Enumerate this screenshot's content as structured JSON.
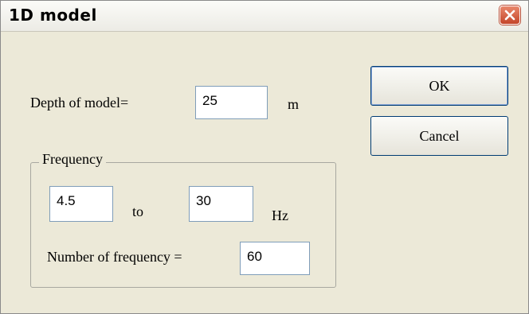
{
  "window": {
    "title": "1D model"
  },
  "depth": {
    "label": "Depth of model=",
    "value": "25",
    "unit": "m"
  },
  "buttons": {
    "ok": "OK",
    "cancel": "Cancel"
  },
  "frequency_group": {
    "legend": "Frequency",
    "from_value": "4.5",
    "to_label": "to",
    "to_value": "30",
    "unit": "Hz",
    "count_label": "Number of frequency =",
    "count_value": "60"
  }
}
